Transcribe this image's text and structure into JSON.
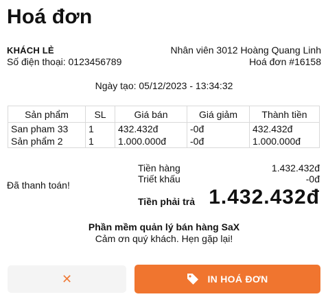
{
  "invoice": {
    "title": "Hoá đơn",
    "customer_name": "KHÁCH LẺ",
    "phone": "Số điện thoại: 0123456789",
    "staff": "Nhân viên 3012 Hoàng Quang Linh",
    "invoice_no": "Hoá đơn #16158",
    "created": "Ngày tạo: 05/12/2023 - 13:34:32"
  },
  "table": {
    "headers": [
      "Sản phẩm",
      "SL",
      "Giá bán",
      "Giá giảm",
      "Thành tiền"
    ],
    "rows": [
      [
        "San pham 33",
        "1",
        "432.432đ",
        "-0đ",
        "432.432đ"
      ],
      [
        "Sản phẩm 2",
        "1",
        "1.000.000đ",
        "-0đ",
        "1.000.000đ"
      ]
    ]
  },
  "payment": {
    "status": "Đã thanh toán!"
  },
  "totals": {
    "subtotal_label": "Tiền hàng",
    "subtotal_value": "1.432.432đ",
    "discount_label": "Triết khấu",
    "discount_value": "-0đ",
    "grand_label": "Tiền phải trả",
    "grand_value": "1.432.432đ"
  },
  "footer": {
    "brand": "Phần mềm quản lý bán hàng SaX",
    "thanks": "Cảm ơn quý khách. Hẹn gặp lại!"
  },
  "actions": {
    "cancel_icon": "close-icon",
    "cancel_glyph": "✕",
    "print_icon": "tag-icon",
    "print_label": "IN HOÁ ĐƠN",
    "accent_color": "#f0752f"
  }
}
